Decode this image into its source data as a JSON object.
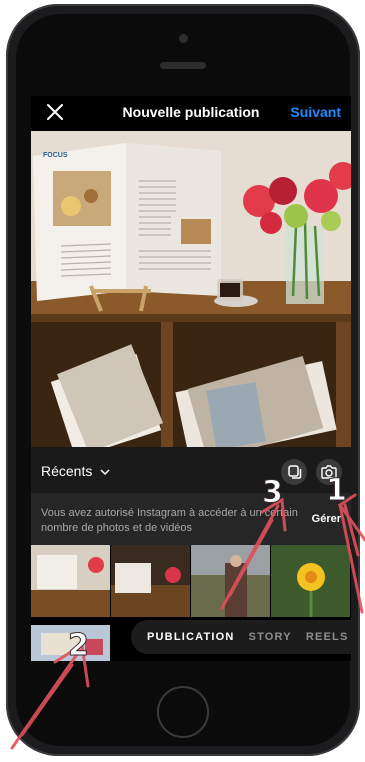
{
  "header": {
    "title": "Nouvelle publication",
    "next_label": "Suivant"
  },
  "library": {
    "album_label": "Récents",
    "notice_text": "Vous avez autorisé Instagram à accéder à un certain nombre de photos et de vidéos",
    "notice_action": "Gérer"
  },
  "photo_preview": {
    "magazine_heading": "FOCUS"
  },
  "mode_tabs": [
    {
      "label": "PUBLICATION",
      "active": true
    },
    {
      "label": "STORY",
      "active": false
    },
    {
      "label": "REELS",
      "active": false
    }
  ],
  "annotations": {
    "marker_1": "1",
    "marker_2": "2",
    "marker_3": "3",
    "arrow_color": "#e0505a"
  },
  "icons": {
    "close": "close-icon",
    "album_chevron": "chevron-down-icon",
    "multi_select": "multi-select-icon",
    "camera": "camera-icon"
  },
  "colors": {
    "accent": "#1a8cff",
    "background": "#000000"
  }
}
